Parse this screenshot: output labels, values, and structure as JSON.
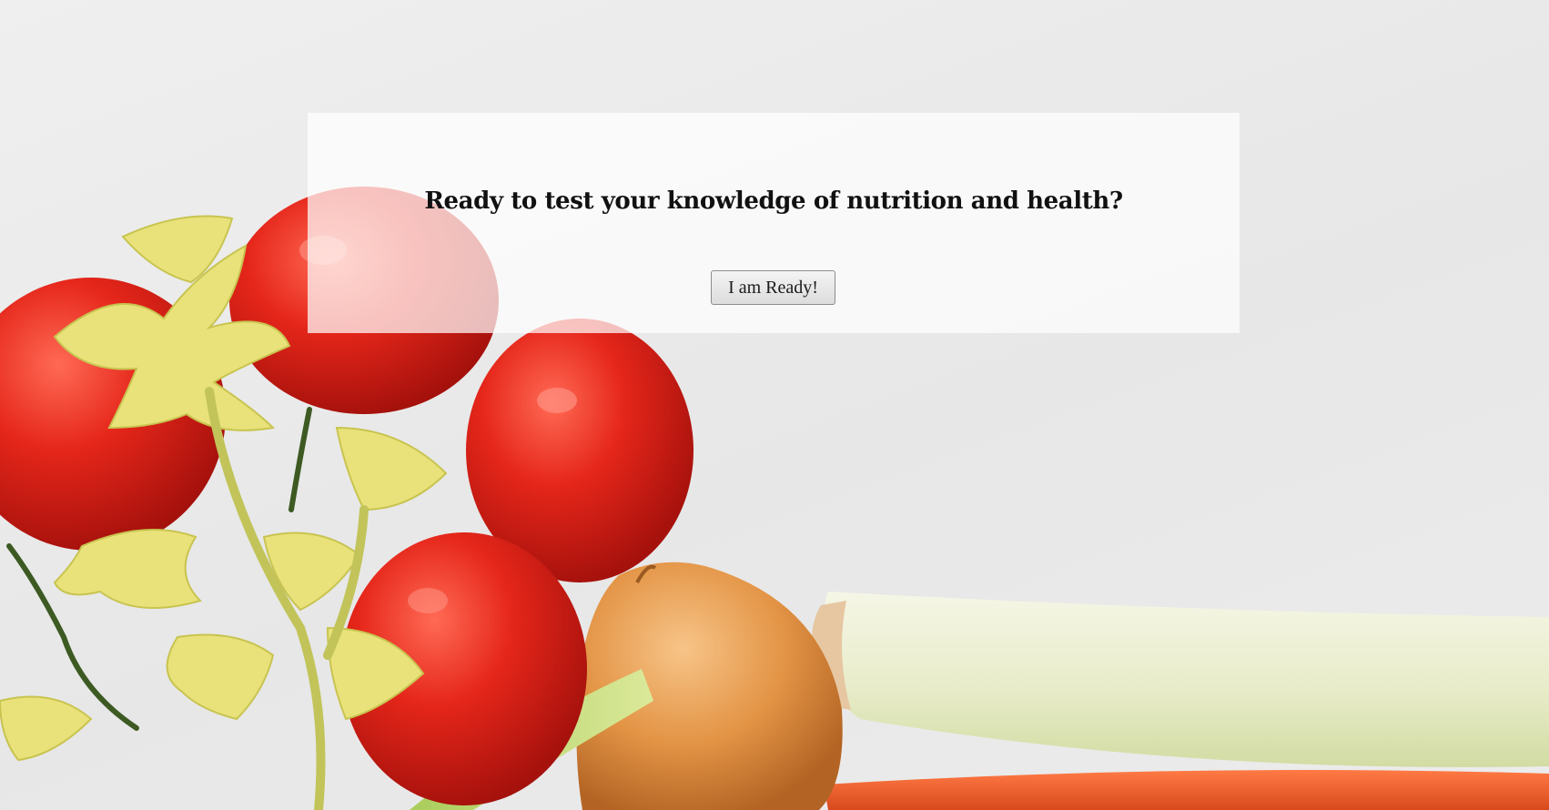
{
  "hero": {
    "question": "Ready to test your knowledge of nutrition and health?",
    "start_button_label": "I am Ready!"
  },
  "background": {
    "description_icon": "vegetables-photo",
    "colors": {
      "paper": "#ebebeb",
      "tomato": "#e02a1e",
      "celery": "#e9e27a",
      "onion": "#e8a055",
      "leek": "#eef0d6",
      "carrot": "#f25c2a"
    }
  }
}
